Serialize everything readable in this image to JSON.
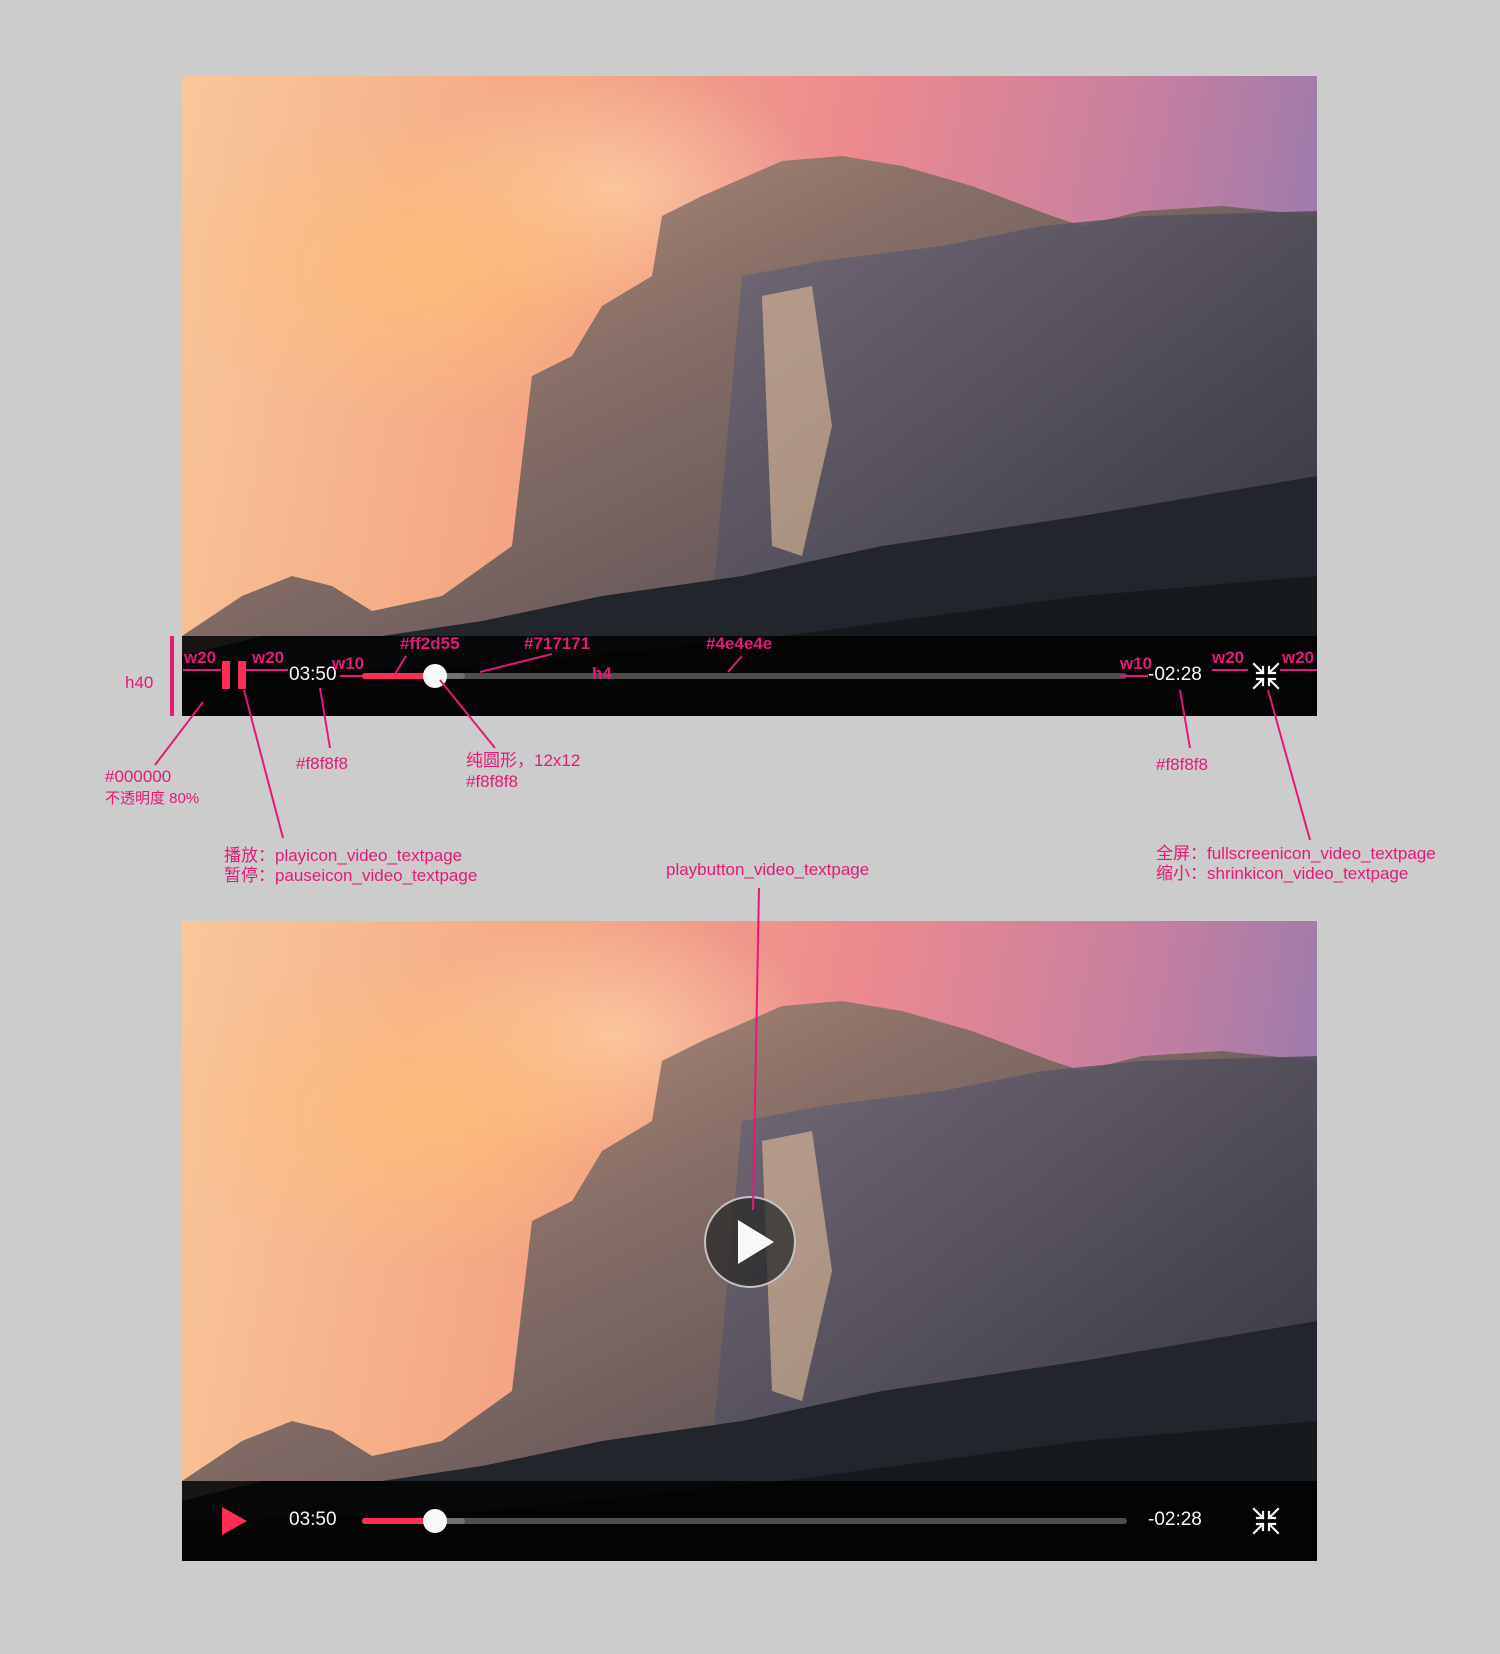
{
  "colors": {
    "accent": "#ff2d55",
    "buffer": "#717171",
    "track": "#4e4e4e",
    "text": "#f8f8f8",
    "bar": "#000000",
    "annotation": "#e5197a"
  },
  "player_top": {
    "current_time": "03:50",
    "remaining_time": "-02:28",
    "progress": 0.095,
    "buffered": 0.135,
    "state_icon": "pause-icon",
    "screen_icon": "shrink-icon"
  },
  "player_bottom": {
    "current_time": "03:50",
    "remaining_time": "-02:28",
    "progress": 0.095,
    "buffered": 0.135,
    "state_icon": "play-icon",
    "screen_icon": "shrink-icon",
    "center_icon": "play-button-icon"
  },
  "annotations": {
    "h40": "h40",
    "w20_left": "w20",
    "w20_after_icon": "w20",
    "w10_left": "w10",
    "played_color": "#ff2d55",
    "buffer_color": "#717171",
    "track_color": "#4e4e4e",
    "h4": "h4",
    "w10_right": "w10",
    "w20_before_icon": "w20",
    "w20_right": "w20",
    "bar_color": "#000000",
    "bar_opacity": "不透明度 80%",
    "time_color_left": "#f8f8f8",
    "knob_desc": "纯圆形，12x12",
    "knob_color": "#f8f8f8",
    "time_color_right": "#f8f8f8",
    "play_label": "播放：playicon_video_textpage",
    "pause_label": "暂停：pauseicon_video_textpage",
    "fullscreen_label": "全屏：fullscreenicon_video_textpage",
    "shrink_label": "缩小：shrinkicon_video_textpage",
    "playbutton_label": "playbutton_video_textpage"
  }
}
